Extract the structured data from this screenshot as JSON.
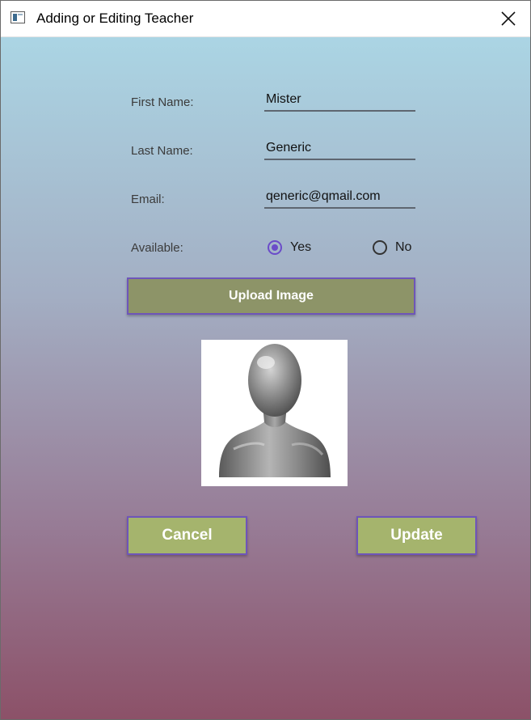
{
  "window": {
    "title": "Adding or Editing Teacher"
  },
  "form": {
    "first_name": {
      "label": "First Name:",
      "value": "Mister"
    },
    "last_name": {
      "label": "Last Name:",
      "value": "Generic"
    },
    "email": {
      "label": "Email:",
      "value": "qeneric@qmail.com"
    },
    "available": {
      "label": "Available:",
      "options": [
        {
          "label": "Yes",
          "selected": true
        },
        {
          "label": "No",
          "selected": false
        }
      ]
    }
  },
  "buttons": {
    "upload": "Upload Image",
    "cancel": "Cancel",
    "update": "Update"
  },
  "icons": {
    "app": "app-window-icon",
    "close": "close-icon",
    "avatar": "generic-user-avatar"
  },
  "colors": {
    "gradient_top": "#abd5e4",
    "gradient_bottom": "#8c5168",
    "upload_button": "#8d9468",
    "action_button": "#a5b46d",
    "button_border": "#6e55b9",
    "radio_accent": "#6b4cc9"
  }
}
